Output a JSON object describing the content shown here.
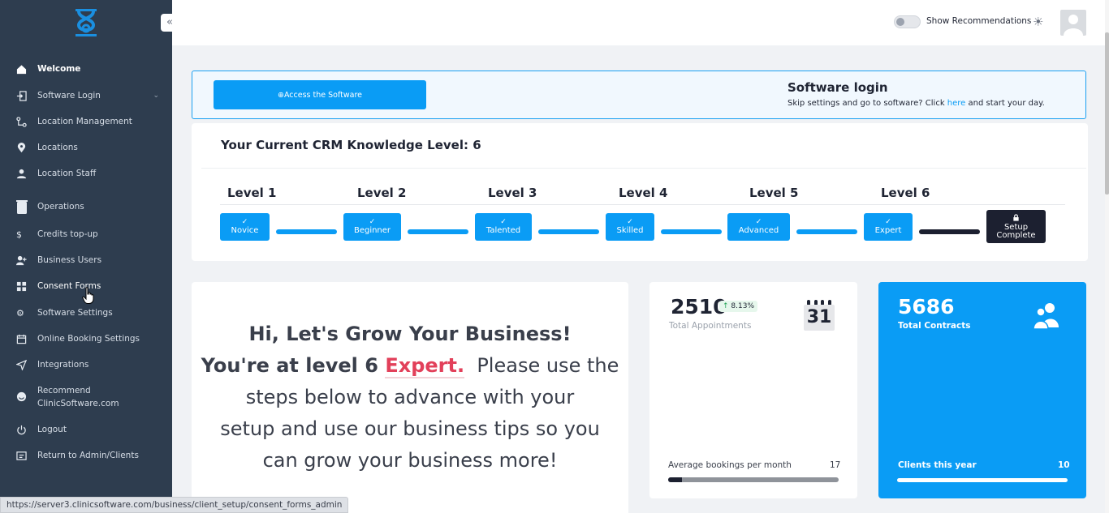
{
  "sidebar": {
    "collapse_icon": "«",
    "items": [
      {
        "label": "Welcome",
        "icon": "home-icon"
      },
      {
        "label": "Software Login",
        "icon": "login-icon"
      },
      {
        "label": "Location Management",
        "icon": "location-management-icon"
      },
      {
        "label": "Locations",
        "icon": "map-pin-icon"
      },
      {
        "label": "Location Staff",
        "icon": "staff-icon"
      },
      {
        "label": "Operations",
        "icon": "trash-icon"
      },
      {
        "label": "Credits top-up",
        "icon": "dollar-icon"
      },
      {
        "label": "Business Users",
        "icon": "user-plus-icon"
      },
      {
        "label": "Consent Forms",
        "icon": "dashboard-icon"
      },
      {
        "label": "Software Settings",
        "icon": "gear-icon"
      },
      {
        "label": "Online Booking Settings",
        "icon": "calendar-icon"
      },
      {
        "label": "Integrations",
        "icon": "send-icon"
      },
      {
        "label": "Recommend",
        "label2": "ClinicSoftware.com",
        "icon": "smile-icon"
      },
      {
        "label": "Logout",
        "icon": "power-icon"
      },
      {
        "label": "Return to Admin/Clients",
        "icon": "return-icon"
      }
    ]
  },
  "topbar": {
    "recommendations_label": "Show Recommendations",
    "sun_icon": "☀"
  },
  "login_banner": {
    "button_label": "⊕Access the Software",
    "title": "Software login",
    "sub_before": "Skip settings and go to software? Click ",
    "sub_link": "here",
    "sub_after": " and start your day."
  },
  "crm": {
    "title": "Your Current CRM Knowledge Level: 6",
    "levels": [
      "Level 1",
      "Level 2",
      "Level 3",
      "Level 4",
      "Level 5",
      "Level 6"
    ],
    "steps": [
      "Novice",
      "Beginner",
      "Talented",
      "Skilled",
      "Advanced",
      "Expert"
    ],
    "final_step_line1": "Setup",
    "final_step_line2": "Complete",
    "check": "✓",
    "lock": "🔒"
  },
  "welcome": {
    "line1": "Hi, Let's Grow Your Business!",
    "line2_before": "You're at level 6 ",
    "line2_highlight": "Expert.",
    "line2_after": "  Please use the",
    "line3": "steps below to advance with your",
    "line4": "setup and use our business tips so you",
    "line5": "can grow your business more!"
  },
  "appointments": {
    "value": "2510",
    "change": "8.13%",
    "change_arrow": "↑",
    "label": "Total Appointments",
    "calendar_day": "31",
    "avg_label": "Average bookings per month",
    "avg_value": "17",
    "avg_progress": 0.08
  },
  "contracts": {
    "value": "5686",
    "label": "Total Contracts",
    "clients_label": "Clients this year",
    "clients_value": "10"
  },
  "status_url": "https://server3.clinicsoftware.com/business/client_setup/consent_forms_admin",
  "colors": {
    "sidebar_bg": "#2e3d4f",
    "accent": "#0a9cf5",
    "dark": "#1c2030",
    "expert": "#e2405a"
  }
}
